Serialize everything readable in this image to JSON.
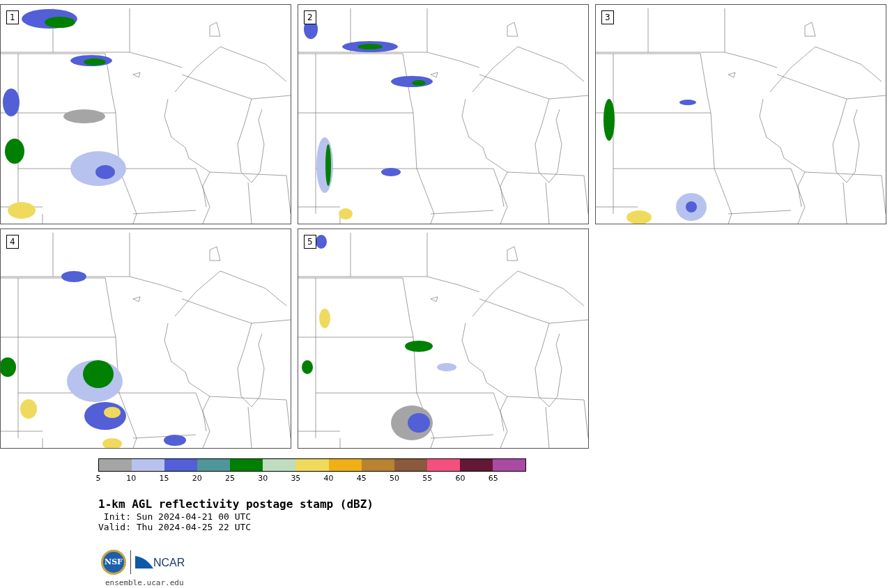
{
  "panels": [
    {
      "label": "1"
    },
    {
      "label": "2"
    },
    {
      "label": "3"
    },
    {
      "label": "4"
    },
    {
      "label": "5"
    }
  ],
  "colorbar": {
    "bins": [
      {
        "color": "#a5a5a5"
      },
      {
        "color": "#b8c2ee"
      },
      {
        "color": "#535fd6"
      },
      {
        "color": "#4f969b"
      },
      {
        "color": "#008000"
      },
      {
        "color": "#bfddbf"
      },
      {
        "color": "#f0da5d"
      },
      {
        "color": "#efaf17"
      },
      {
        "color": "#b98331"
      },
      {
        "color": "#8b5a3c"
      },
      {
        "color": "#f4507e"
      },
      {
        "color": "#651836"
      },
      {
        "color": "#ab4aa3"
      }
    ],
    "ticks": [
      "5",
      "10",
      "15",
      "20",
      "25",
      "30",
      "35",
      "40",
      "45",
      "50",
      "55",
      "60",
      "65"
    ]
  },
  "title": "1-km AGL reflectivity postage stamp (dBZ)",
  "init": " Init: Sun 2024-04-21 00 UTC",
  "valid": "Valid: Thu 2024-04-25 22 UTC",
  "logo": {
    "text": "NCAR",
    "seal_text": "NSF"
  },
  "url": "ensemble.ucar.edu"
}
